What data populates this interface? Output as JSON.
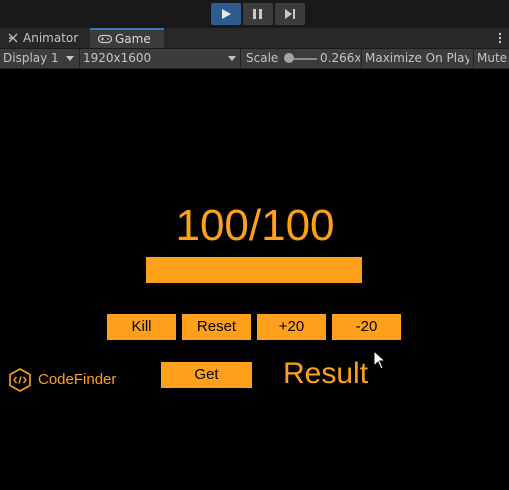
{
  "play_controls": {
    "play_icon": "play-icon",
    "pause_icon": "pause-icon",
    "step_icon": "step-icon"
  },
  "tabs": [
    {
      "label": "Animator",
      "icon": "animator-icon",
      "active": false
    },
    {
      "label": "Game",
      "icon": "gamepad-icon",
      "active": true
    }
  ],
  "toolbar": {
    "display": "Display 1",
    "resolution": "1920x1600",
    "scale_label": "Scale",
    "scale_value": "0.266x",
    "maximize_on_play": "Maximize On Play",
    "mute": "Mute"
  },
  "game": {
    "health_text": "100/100",
    "health_fraction": 1.0,
    "buttons": {
      "kill": "Kill",
      "reset": "Reset",
      "plus": "+20",
      "minus": "-20",
      "get": "Get"
    },
    "result": "Result",
    "logo_text": "CodeFinder"
  },
  "colors": {
    "accent": "#ffa01c",
    "play_active": "#2f5c8f",
    "editor_dark": "#191919",
    "editor_panel": "#3c3c3c"
  }
}
